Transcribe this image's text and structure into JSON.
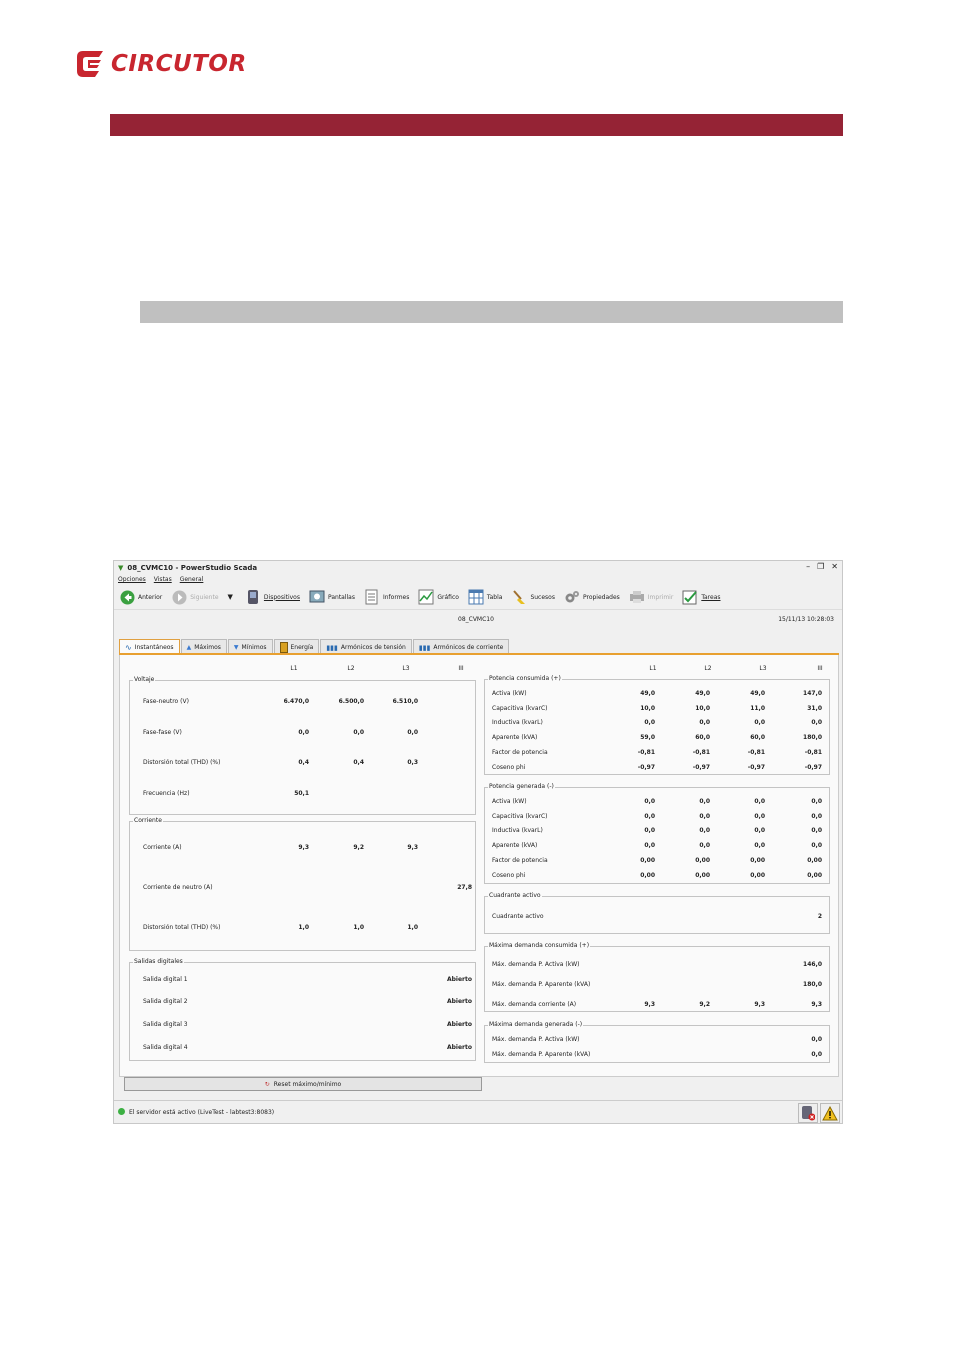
{
  "logo": {
    "text": "CIRCUTOR"
  },
  "window": {
    "title": "08_CVMC10 - PowerStudio Scada",
    "menu": [
      "Opciones",
      "Vistas",
      "General"
    ],
    "toolbar": [
      {
        "label": "Anterior",
        "icon": "back-arrow-icon",
        "enabled": true
      },
      {
        "label": "Siguiente",
        "icon": "forward-arrow-icon",
        "enabled": false
      },
      {
        "label": "Dispositivos",
        "icon": "device-icon",
        "enabled": true
      },
      {
        "label": "Pantallas",
        "icon": "screen-icon",
        "enabled": true
      },
      {
        "label": "Informes",
        "icon": "report-icon",
        "enabled": true
      },
      {
        "label": "Gráfico",
        "icon": "chart-icon",
        "enabled": true
      },
      {
        "label": "Tabla",
        "icon": "table-icon",
        "enabled": true
      },
      {
        "label": "Sucesos",
        "icon": "broom-icon",
        "enabled": true
      },
      {
        "label": "Propiedades",
        "icon": "gears-icon",
        "enabled": true
      },
      {
        "label": "Imprimir",
        "icon": "printer-icon",
        "enabled": false
      },
      {
        "label": "Tareas",
        "icon": "tasks-icon",
        "enabled": true
      }
    ],
    "device_name": "08_CVMC10",
    "datetime": "15/11/13 10:28:03",
    "tabs": [
      "Instantáneos",
      "Máximos",
      "Mínimos",
      "Energía",
      "Armónicos de tensión",
      "Armónicos de corriente"
    ],
    "active_tab": "Instantáneos"
  },
  "left": {
    "col_headers": [
      "L1",
      "L2",
      "L3",
      "III"
    ],
    "voltaje": {
      "title": "Voltaje",
      "rows": [
        {
          "label": "Fase-neutro (V)",
          "values": [
            "6.470,0",
            "6.500,0",
            "6.510,0",
            ""
          ]
        },
        {
          "label": "Fase-fase (V)",
          "values": [
            "0,0",
            "0,0",
            "0,0",
            ""
          ]
        },
        {
          "label": "Distorsión total (THD) (%)",
          "values": [
            "0,4",
            "0,4",
            "0,3",
            ""
          ]
        },
        {
          "label": "Frecuencia (Hz)",
          "values": [
            "50,1",
            "",
            "",
            ""
          ]
        }
      ]
    },
    "corriente": {
      "title": "Corriente",
      "rows": [
        {
          "label": "Corriente (A)",
          "values": [
            "9,3",
            "9,2",
            "9,3",
            ""
          ]
        },
        {
          "label": "Corriente de neutro (A)",
          "values": [
            "",
            "",
            "",
            "27,8"
          ]
        },
        {
          "label": "Distorsión total (THD) (%)",
          "values": [
            "1,0",
            "1,0",
            "1,0",
            ""
          ]
        }
      ]
    },
    "salidas": {
      "title": "Salidas digitales",
      "rows": [
        {
          "label": "Salida digital 1",
          "value": "Abierto"
        },
        {
          "label": "Salida digital 2",
          "value": "Abierto"
        },
        {
          "label": "Salida digital 3",
          "value": "Abierto"
        },
        {
          "label": "Salida digital 4",
          "value": "Abierto"
        }
      ]
    }
  },
  "right": {
    "col_headers": [
      "L1",
      "L2",
      "L3",
      "III"
    ],
    "consumida": {
      "title": "Potencia consumida (+)",
      "rows": [
        {
          "label": "Activa (kW)",
          "values": [
            "49,0",
            "49,0",
            "49,0",
            "147,0"
          ]
        },
        {
          "label": "Capacitiva (kvarC)",
          "values": [
            "10,0",
            "10,0",
            "11,0",
            "31,0"
          ]
        },
        {
          "label": "Inductiva (kvarL)",
          "values": [
            "0,0",
            "0,0",
            "0,0",
            "0,0"
          ]
        },
        {
          "label": "Aparente (kVA)",
          "values": [
            "59,0",
            "60,0",
            "60,0",
            "180,0"
          ]
        },
        {
          "label": "Factor de potencia",
          "values": [
            "-0,81",
            "-0,81",
            "-0,81",
            "-0,81"
          ]
        },
        {
          "label": "Coseno phi",
          "values": [
            "-0,97",
            "-0,97",
            "-0,97",
            "-0,97"
          ]
        }
      ]
    },
    "generada": {
      "title": "Potencia generada (-)",
      "rows": [
        {
          "label": "Activa (kW)",
          "values": [
            "0,0",
            "0,0",
            "0,0",
            "0,0"
          ]
        },
        {
          "label": "Capacitiva (kvarC)",
          "values": [
            "0,0",
            "0,0",
            "0,0",
            "0,0"
          ]
        },
        {
          "label": "Inductiva (kvarL)",
          "values": [
            "0,0",
            "0,0",
            "0,0",
            "0,0"
          ]
        },
        {
          "label": "Aparente (kVA)",
          "values": [
            "0,0",
            "0,0",
            "0,0",
            "0,0"
          ]
        },
        {
          "label": "Factor de potencia",
          "values": [
            "0,00",
            "0,00",
            "0,00",
            "0,00"
          ]
        },
        {
          "label": "Coseno phi",
          "values": [
            "0,00",
            "0,00",
            "0,00",
            "0,00"
          ]
        }
      ]
    },
    "cuadrante": {
      "title": "Cuadrante activo",
      "rows": [
        {
          "label": "Cuadrante activo",
          "values": [
            "",
            "",
            "",
            "2"
          ]
        }
      ]
    },
    "max_consumida": {
      "title": "Máxima demanda consumida (+)",
      "rows": [
        {
          "label": "Máx. demanda P. Activa (kW)",
          "values": [
            "",
            "",
            "",
            "146,0"
          ]
        },
        {
          "label": "Máx. demanda P. Aparente (kVA)",
          "values": [
            "",
            "",
            "",
            "180,0"
          ]
        },
        {
          "label": "Máx. demanda corriente (A)",
          "values": [
            "9,3",
            "9,2",
            "9,3",
            "9,3"
          ]
        }
      ]
    },
    "max_generada": {
      "title": "Máxima demanda generada (-)",
      "rows": [
        {
          "label": "Máx. demanda P. Activa (kW)",
          "values": [
            "",
            "",
            "",
            "0,0"
          ]
        },
        {
          "label": "Máx. demanda P. Aparente (kVA)",
          "values": [
            "",
            "",
            "",
            "0,0"
          ]
        }
      ]
    }
  },
  "reset_button": "Reset máximo/mínimo",
  "status_text": "El servidor está activo (LiveTest - labtest3:8083)",
  "colors": {
    "brand_red": "#952335",
    "grey_band": "#c0c0c0",
    "tab_accent": "#e8a030"
  }
}
